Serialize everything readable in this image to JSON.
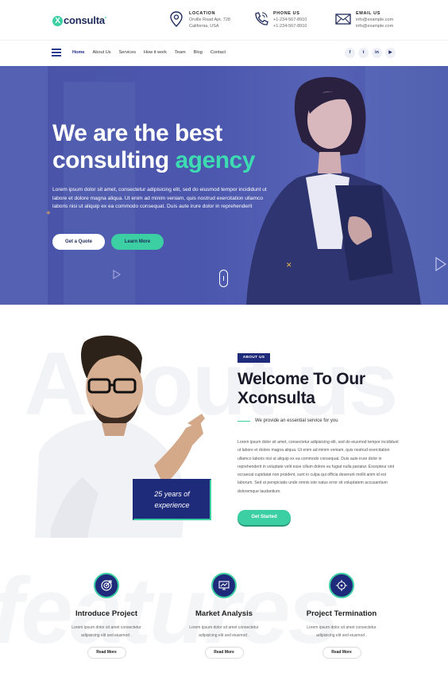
{
  "brand": {
    "logo_initial": "X",
    "logo_rest": "consulta",
    "logo_dot": "•"
  },
  "contact": {
    "location": {
      "label": "LOCATION",
      "line1": "Orville Road Apt. 728",
      "line2": "California, USA"
    },
    "phone": {
      "label": "PHONE US",
      "line1": "+1-234-567-8910",
      "line2": "+1-234-567-8910"
    },
    "email": {
      "label": "EMAIL US",
      "line1": "info@example.com",
      "line2": "info@example.com"
    }
  },
  "nav": {
    "items": [
      "Home",
      "About Us",
      "Services",
      "How it work",
      "Team",
      "Blog",
      "Contact"
    ],
    "social": [
      "f",
      "t",
      "in",
      "▶"
    ]
  },
  "hero": {
    "title_line1": "We are the best",
    "title_line2_a": "consulting",
    "title_line2_b": "agency",
    "text": "Lorem ipsum dolor sit amet, consectetur adipisicing elit, sed do eiusmod tempor incididunt ut labore et dolore magna aliqua. Ut enim ad minim veniam, quis nostrud exercitation ullamco laboris nisi ut aliquip ex ea commodo consequat. Duis aute irure dolor in reprehenderit",
    "btn_quote": "Get a Quote",
    "btn_learn": "Learn More"
  },
  "about": {
    "watermark": "About us",
    "badge": "ABOUT US",
    "title_line1": "Welcome To Our",
    "title_line2": "Xconsulta",
    "subtitle": "We provide an essential service for you",
    "body": "Lorem ipsum dolor sit amet, consectetur adipisicing elit, sed do eiusmod tempor incididunt ut labore et dolore magna aliqua. Ut enim ad minim veniam, quis nostrud exercitation ullamco laboris nisi ut aliquip ex ea commodo consequat. Duis aute irure dolor in reprehenderit in voluptate velit esse cillum dolore eu fugiat nulla pariatur. Excepteur sint occaecat cupidatat non proident, sunt in culpa qui officia deserunt mollit anim id est laborum. Sed ut perspiciatis unde omnis iste natus error sit voluptatem accusantium doloremque laudantium.",
    "years_line1": "25 years of",
    "years_line2": "experience",
    "btn": "Get Started"
  },
  "features": {
    "watermark": "features",
    "items": [
      {
        "title": "Introduce Project",
        "text_line1": "Lorem ipsum dolor sit amet consectetur",
        "text_line2": "adipisicing elit sed eiusmod .",
        "btn": "Read More",
        "icon": "target-icon"
      },
      {
        "title": "Market Analysis",
        "text_line1": "Lorem ipsum dolor sit amet consectetur",
        "text_line2": "adipisicing elit sed eiusmod .",
        "btn": "Read More",
        "icon": "chart-monitor-icon"
      },
      {
        "title": "Project Termination",
        "text_line1": "Lorem ipsum dolor sit amet consectetur",
        "text_line2": "adipisicing elit sed eiusmod .",
        "btn": "Read More",
        "icon": "crosshair-icon"
      }
    ]
  },
  "colors": {
    "primary": "#1e2a7a",
    "accent": "#3ccfa3",
    "hero_overlay": "#4b57ab"
  }
}
